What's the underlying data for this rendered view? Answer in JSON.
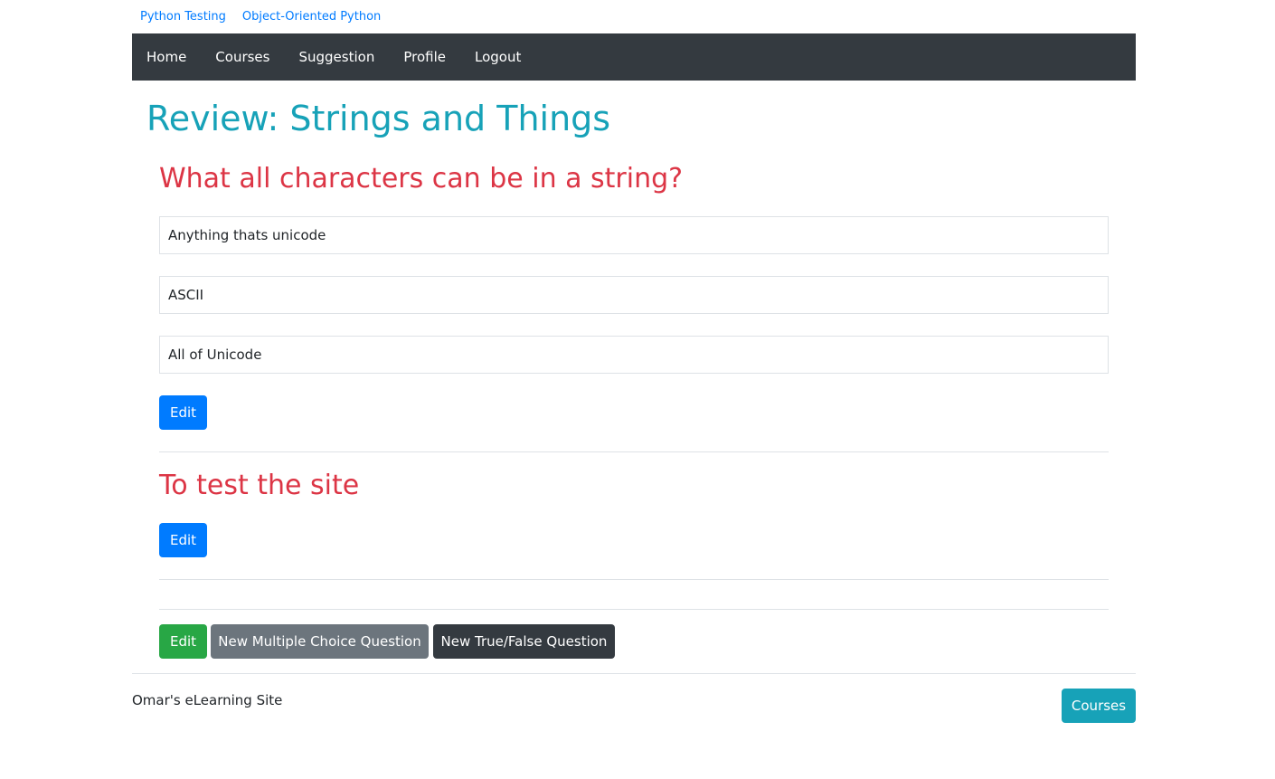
{
  "breadcrumbs": [
    {
      "label": "Python Testing"
    },
    {
      "label": "Object-Oriented Python"
    }
  ],
  "nav": {
    "items": [
      {
        "label": "Home"
      },
      {
        "label": "Courses"
      },
      {
        "label": "Suggestion"
      },
      {
        "label": "Profile"
      },
      {
        "label": "Logout"
      }
    ]
  },
  "page": {
    "title": "Review: Strings and Things"
  },
  "questions": [
    {
      "prompt": "What all characters can be in a string?",
      "answers": [
        "Anything thats unicode",
        "ASCII",
        "All of Unicode"
      ],
      "edit_label": "Edit"
    },
    {
      "prompt": "To test the site",
      "answers": [],
      "edit_label": "Edit"
    }
  ],
  "actions": {
    "edit_label": "Edit",
    "new_mc_label": "New Multiple Choice Question",
    "new_tf_label": "New True/False Question"
  },
  "footer": {
    "site_name": "Omar's eLearning Site",
    "courses_label": "Courses"
  },
  "colors": {
    "title": "#17a2b8",
    "question": "#dc3545",
    "navbar": "#343a40",
    "primary": "#007bff",
    "success": "#28a745",
    "secondary": "#6c757d",
    "info": "#17a2b8"
  }
}
